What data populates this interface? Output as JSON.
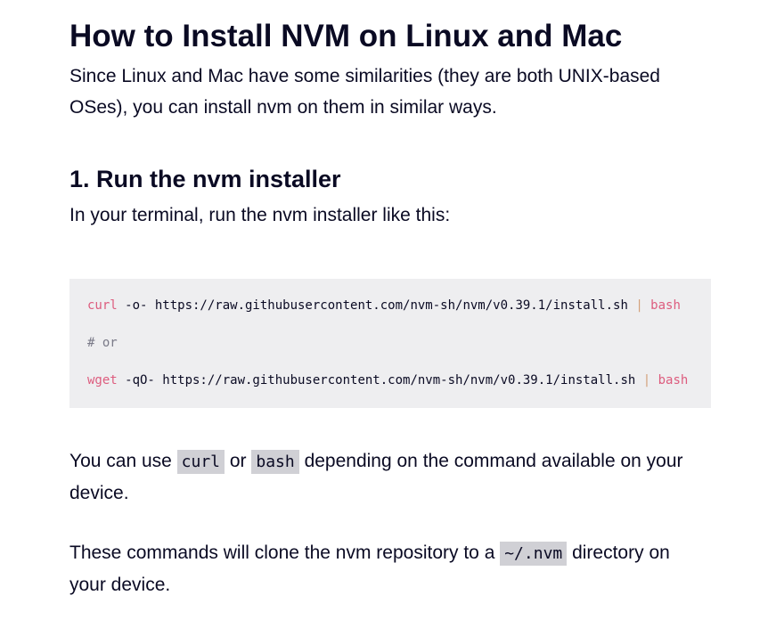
{
  "heading": "How to Install NVM on Linux and Mac",
  "intro": "Since Linux and Mac have some similarities (they are both UNIX-based OSes), you can install nvm on them in similar ways.",
  "step1": {
    "heading": "1. Run the nvm installer",
    "text": "In your terminal, run the nvm installer like this:"
  },
  "code": {
    "line1": {
      "cmd": "curl",
      "args": " -o- https://raw.githubusercontent.com/nvm-sh/nvm/v0.39.1/install.sh ",
      "pipe": "|",
      "target": " bash"
    },
    "comment": "# or",
    "line3": {
      "cmd": "wget",
      "args": " -qO- https://raw.githubusercontent.com/nvm-sh/nvm/v0.39.1/install.sh ",
      "pipe": "|",
      "target": " bash"
    }
  },
  "para_use": {
    "pre": "You can use ",
    "code1": "curl",
    "mid": " or ",
    "code2": "bash",
    "post": " depending on the command available on your device."
  },
  "para_clone": {
    "pre": "These commands will clone the nvm repository to a ",
    "code": "~/.nvm",
    "post": " directory on your device."
  }
}
